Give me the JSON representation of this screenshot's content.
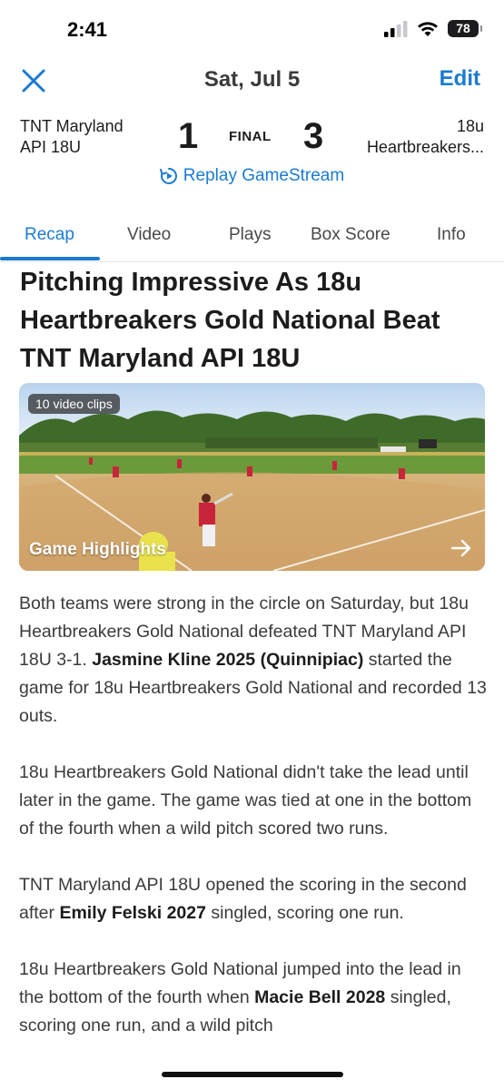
{
  "status": {
    "time": "2:41",
    "battery": "78"
  },
  "nav": {
    "title": "Sat, Jul 5",
    "edit_label": "Edit"
  },
  "game": {
    "home_team_line1": "TNT Maryland",
    "home_team_line2": "API 18U",
    "home_score": "1",
    "status": "FINAL",
    "away_score": "3",
    "away_team_line1": "18u",
    "away_team_line2": "Heartbreakers..."
  },
  "replay_label": "Replay GameStream",
  "tabs": [
    {
      "label": "Recap",
      "active": true
    },
    {
      "label": "Video",
      "active": false
    },
    {
      "label": "Plays",
      "active": false
    },
    {
      "label": "Box Score",
      "active": false
    },
    {
      "label": "Info",
      "active": false
    }
  ],
  "article": {
    "headline": "Pitching Impressive As 18u Heartbreakers Gold National Beat TNT Maryland API 18U",
    "video": {
      "clips_label": "10 video clips",
      "title": "Game Highlights"
    },
    "p1_a": "Both teams were strong in the circle on Saturday, but 18u Heartbreakers Gold National defeated TNT Maryland API 18U 3-1. ",
    "p1_bold": "Jasmine Kline 2025 (Quinnipiac)",
    "p1_b": " started the game for 18u Heartbreakers Gold National and recorded 13 outs.",
    "p2": "18u Heartbreakers Gold National didn't take the lead until later in the game. The game was tied at one in the bottom of the fourth when a wild pitch scored two runs.",
    "p3_a": "TNT Maryland API 18U opened the scoring in the second after ",
    "p3_bold": "Emily Felski 2027",
    "p3_b": " singled, scoring one run.",
    "p4_a": "18u Heartbreakers Gold National jumped into the lead in the bottom of the fourth when ",
    "p4_bold": "Macie Bell 2028",
    "p4_b": " singled, scoring one run, and a wild pitch"
  },
  "colors": {
    "accent": "#1a7bd0",
    "text": "#1c1c1e"
  }
}
